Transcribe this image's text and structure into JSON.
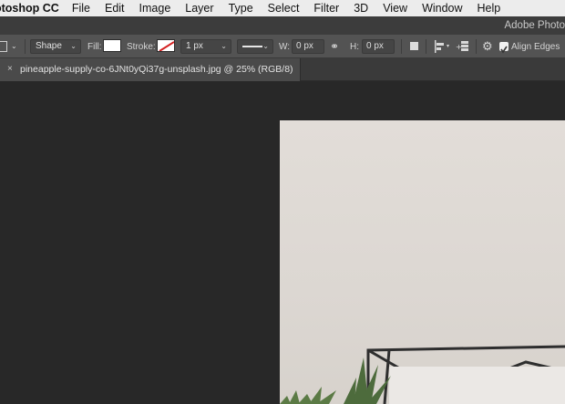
{
  "menubar": {
    "app_name": "otoshop CC",
    "items": [
      "File",
      "Edit",
      "Image",
      "Layer",
      "Type",
      "Select",
      "Filter",
      "3D",
      "View",
      "Window",
      "Help"
    ]
  },
  "titlebar": {
    "title": "Adobe Photo"
  },
  "options": {
    "mode_value": "Shape",
    "fill_label": "Fill:",
    "stroke_label": "Stroke:",
    "stroke_width": "1 px",
    "w_label": "W:",
    "w_value": "0 px",
    "h_label": "H:",
    "h_value": "0 px",
    "align_edges_label": "Align Edges",
    "align_edges_checked": true,
    "fill_color": "#ffffff"
  },
  "document": {
    "tab_title": "pineapple-supply-co-6JNt0yQi37g-unsplash.jpg @ 25% (RGB/8)",
    "close_glyph": "×"
  },
  "colors": {
    "menubar_bg": "#ececec",
    "toolbar_bg": "#535353",
    "workspace_bg": "#282828",
    "photo_wall": "#dfdad5"
  }
}
